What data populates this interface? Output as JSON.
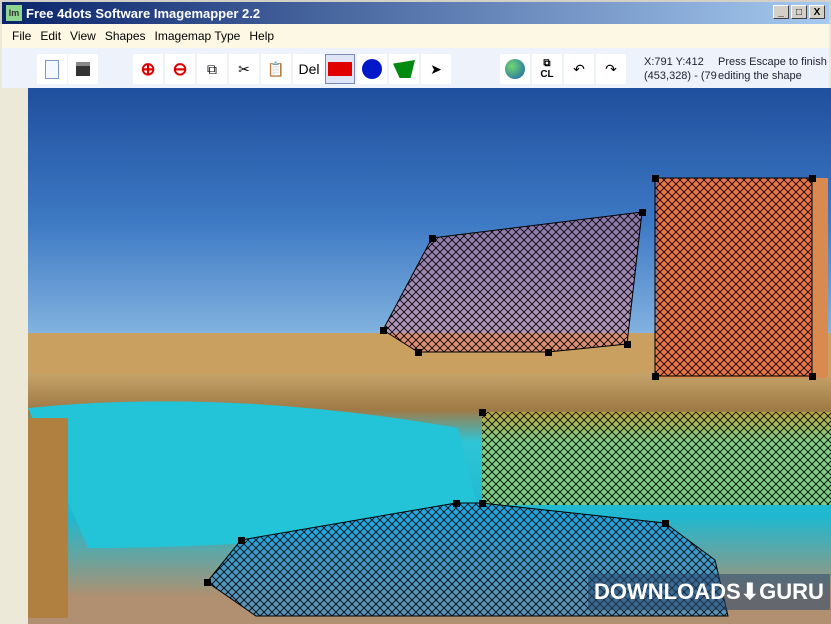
{
  "window": {
    "title": "Free 4dots Software Imagemapper 2.2",
    "icon_text": "Im",
    "minimize": "_",
    "maximize": "□",
    "close": "X"
  },
  "menu": [
    "File",
    "Edit",
    "View",
    "Shapes",
    "Imagemap Type",
    "Help"
  ],
  "toolbar": {
    "del_label": "Del",
    "copy_cl_label": "CL"
  },
  "status": {
    "coords": "X:791 Y:412",
    "selection": "(453,328) - (79",
    "hint": "Press Escape to finish editing the shape"
  },
  "watermark": "DOWNLOADS⬇GURU",
  "colors": {
    "rect_tool": "#e00000",
    "circle_tool": "#0018c8",
    "poly_tool": "#008a10"
  }
}
